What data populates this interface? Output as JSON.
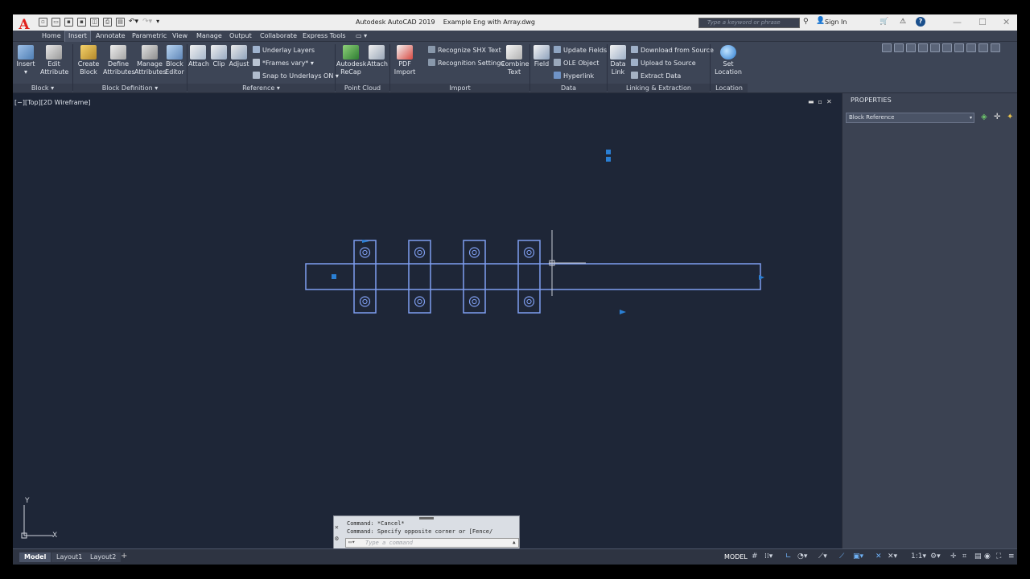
{
  "app": {
    "logo": "A",
    "title": "Autodesk AutoCAD 2019",
    "filename": "Example Eng with Array.dwg"
  },
  "titlebar": {
    "search_placeholder": "Type a keyword or phrase",
    "sign_in": "Sign In"
  },
  "tabs": [
    "Home",
    "Insert",
    "Annotate",
    "Parametric",
    "View",
    "Manage",
    "Output",
    "Collaborate",
    "Express Tools"
  ],
  "active_tab": "Insert",
  "ribbon": {
    "block": {
      "insert": "Insert",
      "edit_attribute": [
        "Edit",
        "Attribute"
      ],
      "label": "Block"
    },
    "block_definition": {
      "create_block": [
        "Create",
        "Block"
      ],
      "define_attributes": [
        "Define",
        "Attributes"
      ],
      "manage_attributes": [
        "Manage",
        "Attributes"
      ],
      "block_editor": [
        "Block",
        "Editor"
      ],
      "label": "Block Definition"
    },
    "reference": {
      "attach": "Attach",
      "clip": "Clip",
      "adjust": "Adjust",
      "underlay_layers": "Underlay Layers",
      "frames_vary": "*Frames vary*",
      "snap_to_underlays": "Snap to Underlays ON",
      "label": "Reference"
    },
    "point_cloud": {
      "recap": [
        "Autodesk",
        "ReCap"
      ],
      "attach": "Attach",
      "label": "Point Cloud"
    },
    "import": {
      "pdf_import": [
        "PDF",
        "Import"
      ],
      "recognize_shx": "Recognize SHX Text",
      "recognition_settings": "Recognition Settings",
      "combine_text": [
        "Combine",
        "Text"
      ],
      "label": "Import"
    },
    "data": {
      "field": "Field",
      "update_fields": "Update Fields",
      "ole_object": "OLE Object",
      "hyperlink": "Hyperlink",
      "label": "Data"
    },
    "linking": {
      "data_link": [
        "Data",
        "Link"
      ],
      "download_from_source": "Download from Source",
      "upload_to_source": "Upload to Source",
      "extract_data": "Extract  Data",
      "label": "Linking & Extraction"
    },
    "location": {
      "set_location": [
        "Set",
        "Location"
      ],
      "label": "Location"
    }
  },
  "viewport": {
    "label": "[−][Top][2D Wireframe]"
  },
  "properties": {
    "title": "PROPERTIES",
    "selection": "Block Reference"
  },
  "command": {
    "line1": "Command: *Cancel*",
    "line2": "Command: Specify opposite corner or [Fence/",
    "placeholder": "Type a command"
  },
  "ucs": {
    "x": "X",
    "y": "Y"
  },
  "layouts": [
    "Model",
    "Layout1",
    "Layout2"
  ],
  "status": {
    "model": "MODEL",
    "scale": "1:1"
  },
  "drawing": {
    "bolt_columns": 4,
    "colors": {
      "line": "#7f9ef0",
      "grip": "#2a7fd4",
      "crosshair": "#c8ccd4",
      "bg": "#1e2637"
    }
  }
}
